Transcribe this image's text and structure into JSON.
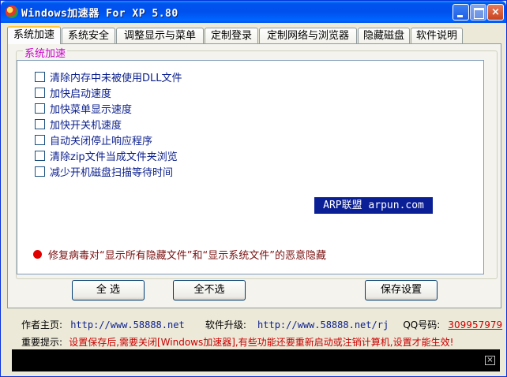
{
  "window": {
    "title": "Windows加速器 For XP 5.80"
  },
  "tabs": [
    {
      "label": "系统加速",
      "active": true
    },
    {
      "label": "系统安全"
    },
    {
      "label": "调整显示与菜单"
    },
    {
      "label": "定制登录"
    },
    {
      "label": "定制网络与浏览器"
    },
    {
      "label": "隐藏磁盘"
    },
    {
      "label": "软件说明"
    }
  ],
  "group": {
    "legend": "系统加速",
    "options": [
      {
        "label": "清除内存中未被使用DLL文件",
        "checked": false
      },
      {
        "label": "加快启动速度",
        "checked": false
      },
      {
        "label": "加快菜单显示速度",
        "checked": false
      },
      {
        "label": "加快开关机速度",
        "checked": false
      },
      {
        "label": "自动关闭停止响应程序",
        "checked": false
      },
      {
        "label": "清除zip文件当成文件夹浏览",
        "checked": false
      },
      {
        "label": "减少开机磁盘扫描等待时间",
        "checked": false
      }
    ],
    "promo": "ARP联盟 arpun.com",
    "fix_option": "修复病毒对“显示所有隐藏文件”和“显示系统文件”的恶意隐藏"
  },
  "buttons": {
    "select_all": "全 选",
    "select_none": "全不选",
    "save": "保存设置"
  },
  "info": {
    "author_label": "作者主页:",
    "author_url": "http://www.58888.net",
    "update_label": "软件升级:",
    "update_url": "http://www.58888.net/rj",
    "qq_label": "QQ号码:",
    "qq_number": "309957979"
  },
  "notice": {
    "label": "重要提示:",
    "text": "设置保存后,需要关闭[Windows加速器],有些功能还要重新启动或注销计算机,设置才能生效!"
  },
  "colors": {
    "titlebar": "#0053ee",
    "legend": "#cc00cc",
    "option_text": "#0a1e8c",
    "promo_bg": "#0a1e96",
    "notice_red": "#cc0000",
    "fix_dot": "#e00000"
  }
}
